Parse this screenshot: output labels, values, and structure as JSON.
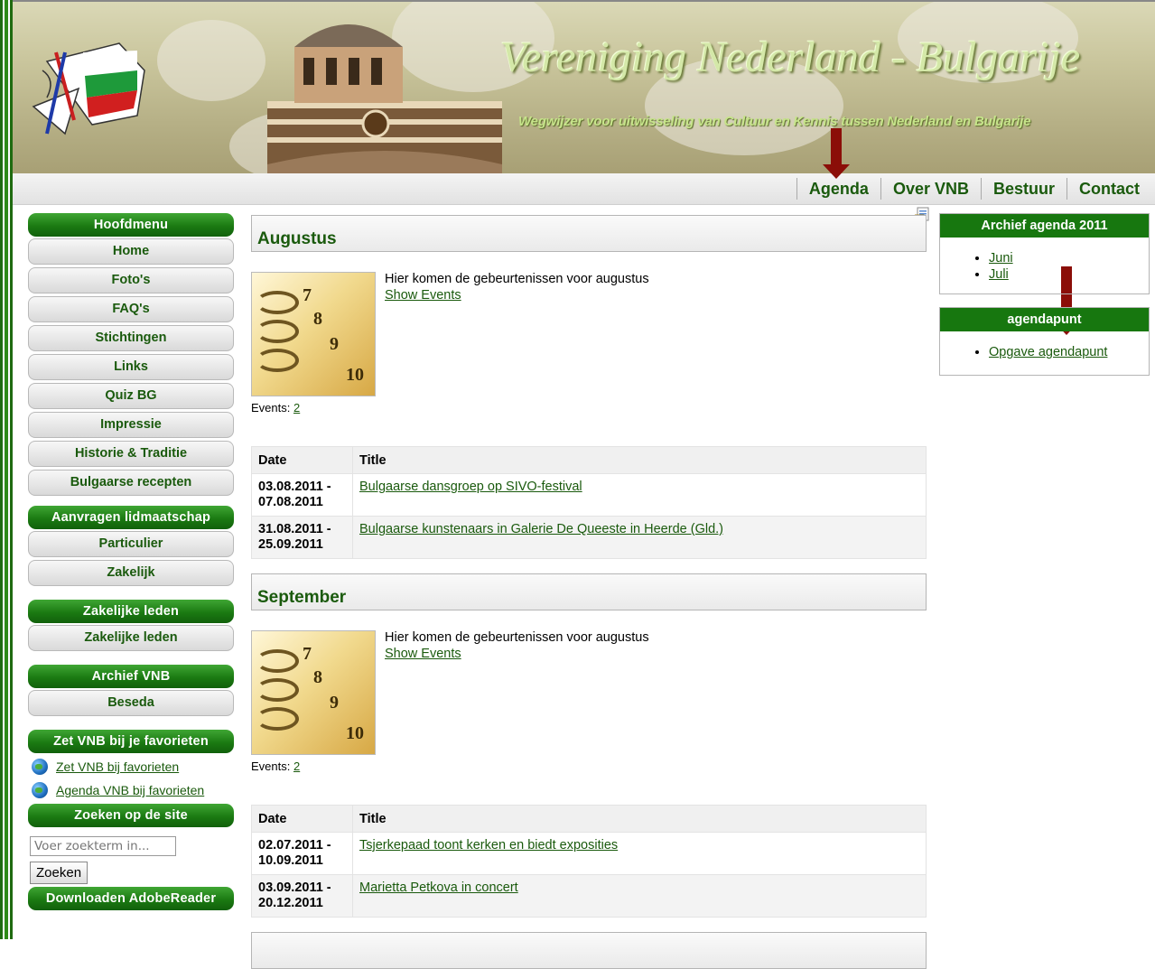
{
  "header": {
    "title": "Vereniging Nederland - Bulgarije",
    "subtitle": "Wegwijzer voor uitwisseling van Cultuur en Kennis tussen Nederland en Bulgarije"
  },
  "topnav": [
    "Agenda",
    "Over VNB",
    "Bestuur",
    "Contact"
  ],
  "sidebar": {
    "hoofdmenu": {
      "title": "Hoofdmenu",
      "items": [
        "Home",
        "Foto's",
        "FAQ's",
        "Stichtingen",
        "Links",
        "Quiz BG",
        "Impressie",
        "Historie & Traditie",
        "Bulgaarse recepten"
      ]
    },
    "lidmaatschap": {
      "title": "Aanvragen lidmaatschap",
      "items": [
        "Particulier",
        "Zakelijk"
      ]
    },
    "zakelijk": {
      "title": "Zakelijke leden",
      "items": [
        "Zakelijke leden"
      ]
    },
    "archief": {
      "title": "Archief VNB",
      "items": [
        "Beseda"
      ]
    },
    "favorieten": {
      "title": "Zet VNB bij je favorieten",
      "links": [
        "Zet VNB bij favorieten",
        "Agenda VNB bij favorieten"
      ]
    },
    "zoeken": {
      "title": "Zoeken op de site",
      "placeholder": "Voer zoekterm in...",
      "button": "Zoeken"
    },
    "download": {
      "title": "Downloaden AdobeReader"
    }
  },
  "months": [
    {
      "name": "Augustus",
      "intro": "Hier komen de gebeurtenissen voor augustus",
      "show_events": "Show Events",
      "events_label": "Events:",
      "events_count": "2",
      "table_headers": [
        "Date",
        "Title"
      ],
      "rows": [
        {
          "date1": "03.08.2011 -",
          "date2": "07.08.2011",
          "title": "Bulgaarse dansgroep op SIVO-festival"
        },
        {
          "date1": "31.08.2011 -",
          "date2": "25.09.2011",
          "title": "Bulgaarse kunstenaars in Galerie De Queeste in Heerde (Gld.)"
        }
      ]
    },
    {
      "name": "September",
      "intro": "Hier komen de gebeurtenissen voor augustus",
      "show_events": "Show Events",
      "events_label": "Events:",
      "events_count": "2",
      "table_headers": [
        "Date",
        "Title"
      ],
      "rows": [
        {
          "date1": "02.07.2011 -",
          "date2": "10.09.2011",
          "title": "Tsjerkepaad toont kerken en biedt exposities"
        },
        {
          "date1": "03.09.2011 -",
          "date2": "20.12.2011",
          "title": "Marietta Petkova in concert"
        }
      ]
    }
  ],
  "calendar_numbers": [
    "7",
    "8",
    "9",
    "10"
  ],
  "right": {
    "archief": {
      "title": "Archief agenda 2011",
      "items": [
        "Juni",
        "Juli"
      ]
    },
    "agendapunt": {
      "title": "agendapunt",
      "items": [
        "Opgave agendapunt"
      ]
    }
  },
  "colors": {
    "brand_green": "#17770f",
    "link_green": "#1a5a0d",
    "annotation_arrow": "#8b0e08"
  }
}
